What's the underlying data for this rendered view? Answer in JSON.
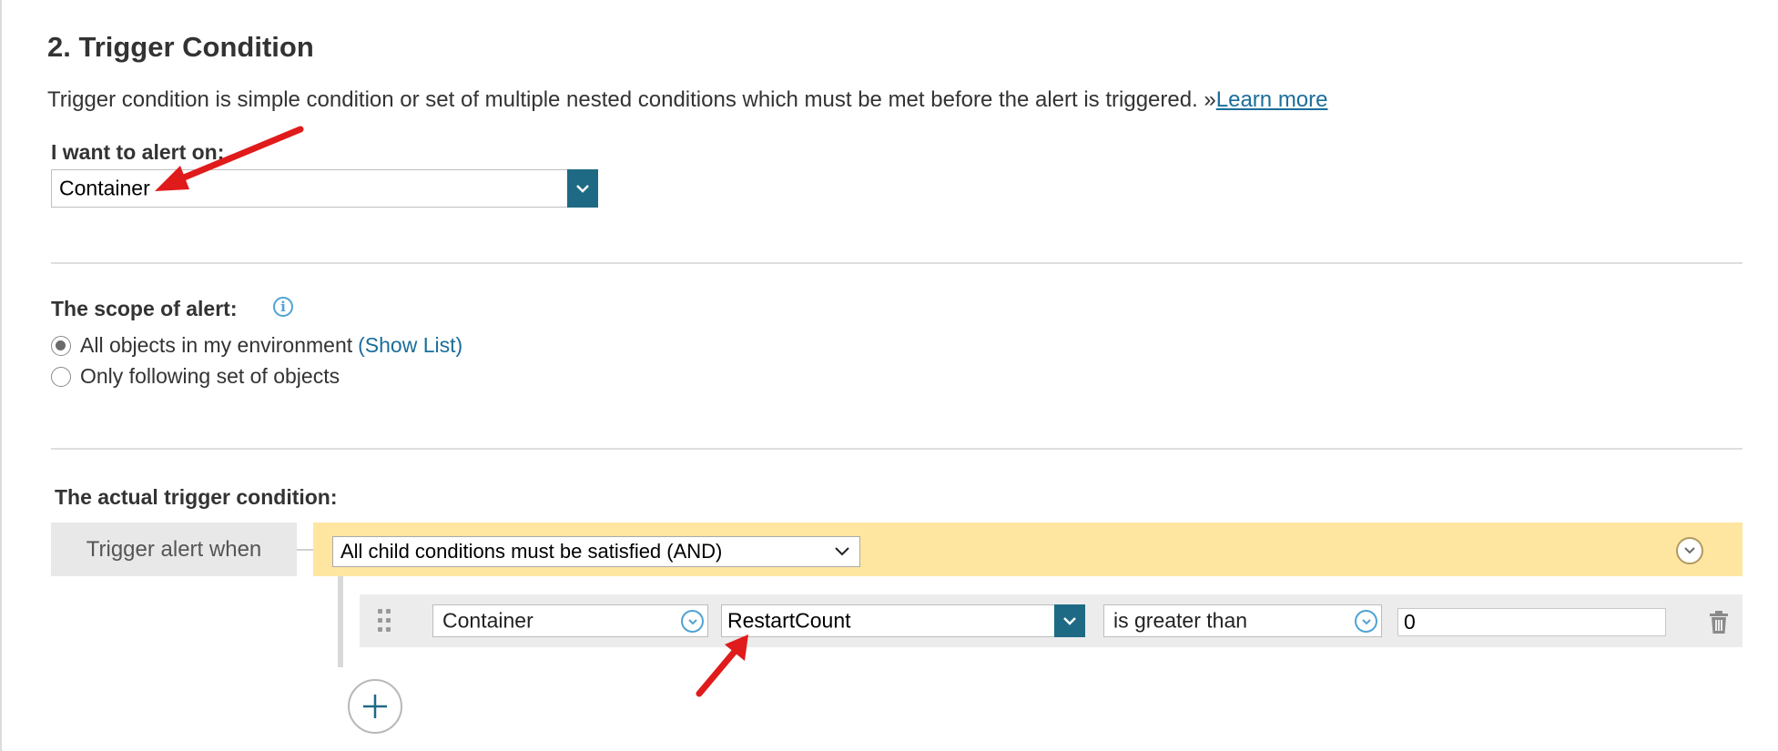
{
  "section": {
    "title": "2. Trigger Condition",
    "description": "Trigger condition is simple condition or set of multiple nested conditions which must be met before the alert is triggered. »",
    "learn_more": "Learn more"
  },
  "alert_on": {
    "label": "I want to alert on:",
    "value": "Container"
  },
  "scope": {
    "label": "The scope of alert:",
    "option_all": "All objects in my environment",
    "show_list": "(Show List)",
    "option_following": "Only following set of objects",
    "selected": "all"
  },
  "trigger": {
    "heading": "The actual trigger condition:",
    "when_label": "Trigger alert when",
    "group_value": "All child conditions must be satisfied (AND)",
    "condition": {
      "object": "Container",
      "metric": "RestartCount",
      "operator": "is greater than",
      "threshold": "0"
    }
  },
  "colors": {
    "accent": "#1e6a85",
    "link": "#1b6e9a",
    "group_bar": "#ffe6a0",
    "annotation_arrow": "#e01b1b"
  },
  "icons": [
    "info-icon",
    "chevron-down-icon",
    "circle-chevron-down-icon",
    "drag-handle-icon",
    "trash-icon",
    "plus-icon",
    "annotation-arrow"
  ]
}
